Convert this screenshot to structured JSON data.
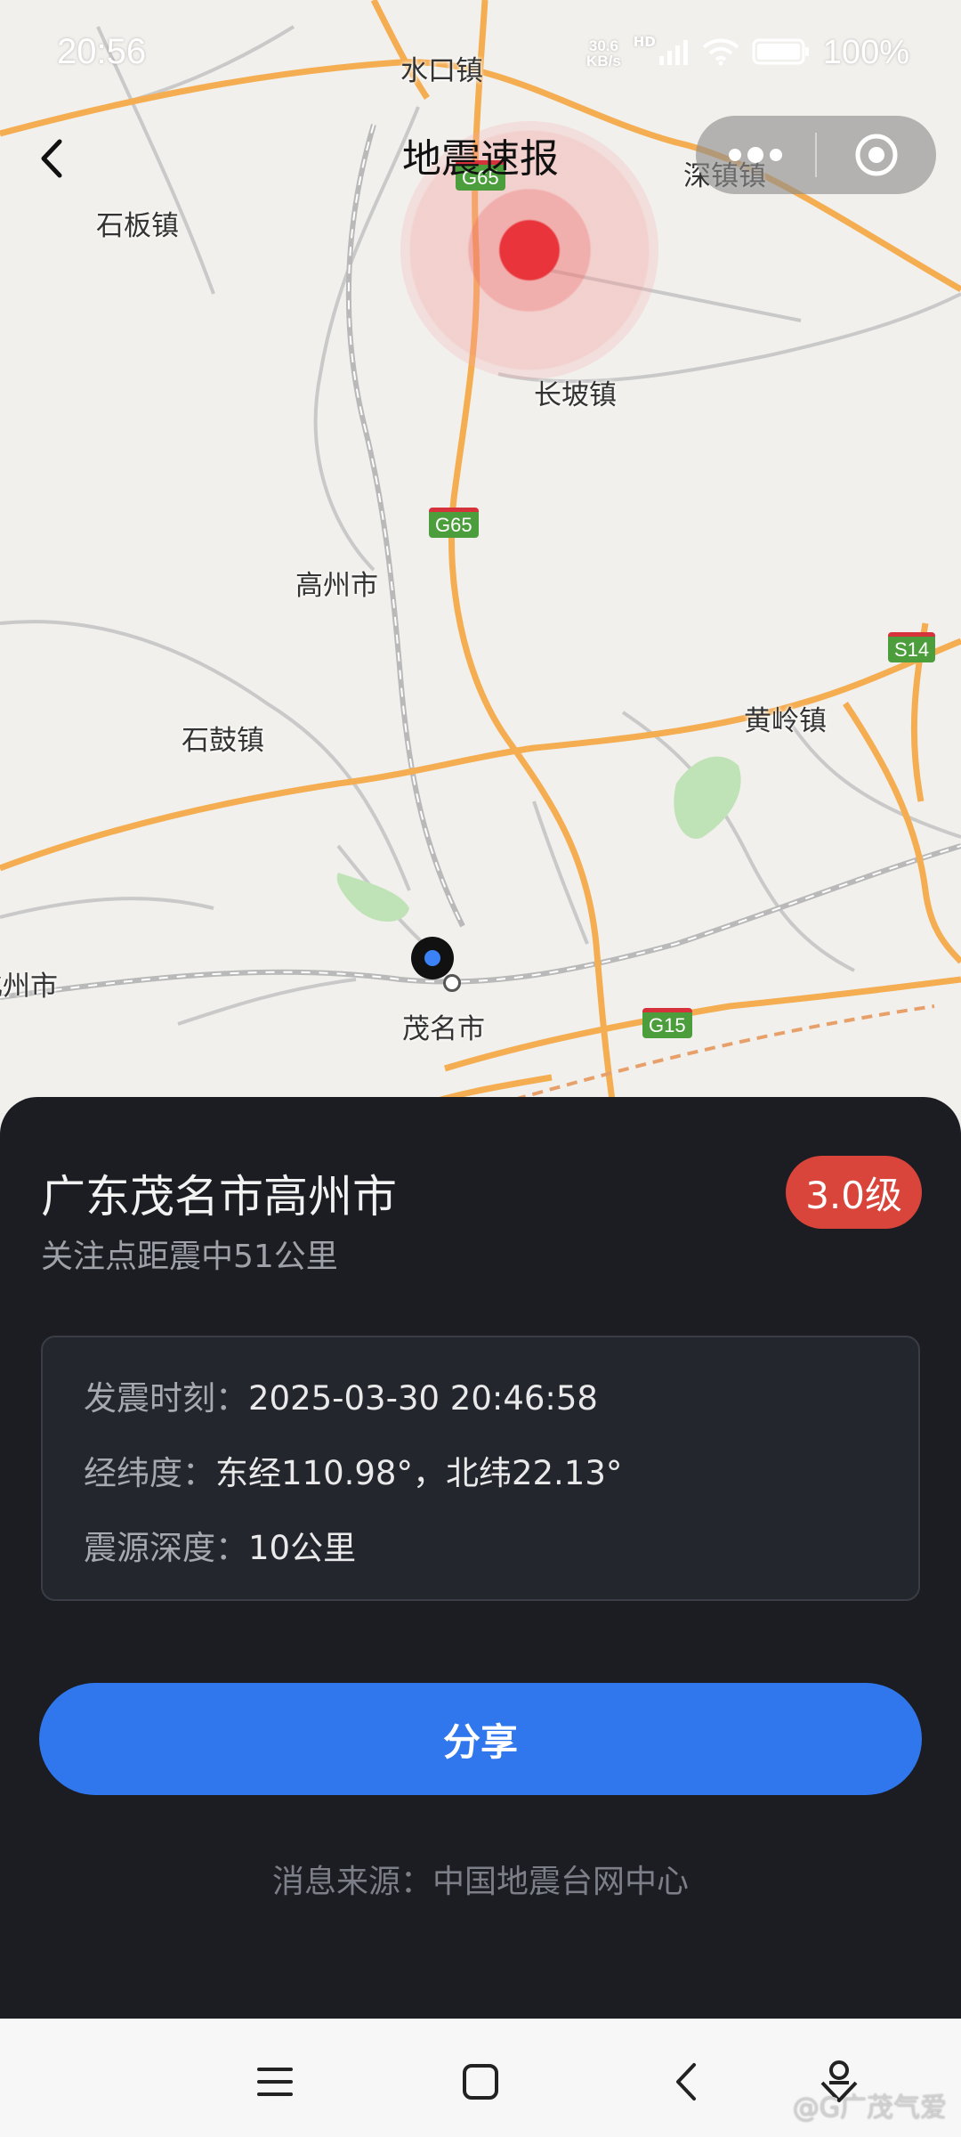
{
  "status_bar": {
    "time": "20:56",
    "net_speed_value": "30.6",
    "net_speed_unit": "KB/s",
    "network_tag": "HD",
    "battery": "100%",
    "icons": [
      "signal-icon",
      "wifi-icon",
      "battery-icon"
    ]
  },
  "header": {
    "title": "地震速报",
    "back_icon": "chevron-left-icon",
    "capsule_icons": [
      "more-dots-icon",
      "target-icon"
    ]
  },
  "map": {
    "labels": {
      "shuikou": "水口镇",
      "shiban": "石板镇",
      "shenzhen_town": "深镇镇",
      "changpo": "长坡镇",
      "gaozhou": "高州市",
      "huangling": "黄岭镇",
      "shigu": "石鼓镇",
      "huazhou_partial": "化州市",
      "maoming": "茂名市"
    },
    "road_shields": {
      "g65_top": "G65",
      "g65_mid": "G65",
      "s14": "S14",
      "g15": "G15"
    },
    "epicenter_color": "#e8343a",
    "user_location_color": "#3b82f6"
  },
  "panel": {
    "location_title": "广东茂名市高州市",
    "distance_text": "关注点距震中51公里",
    "magnitude": "3.0级",
    "magnitude_color": "#d9453a",
    "info": {
      "time_label": "发震时刻：",
      "time_value": "2025-03-30 20:46:58",
      "coord_label": "经纬度：",
      "coord_value": "东经110.98°，北纬22.13°",
      "depth_label": "震源深度：",
      "depth_value": "10公里"
    },
    "share_button": "分享",
    "source_text": "消息来源：中国地震台网中心"
  },
  "nav_bar": {
    "icons": [
      "menu-icon",
      "home-square-icon",
      "back-chevron-icon",
      "assistant-icon"
    ]
  },
  "watermark": "@G广茂气爱"
}
